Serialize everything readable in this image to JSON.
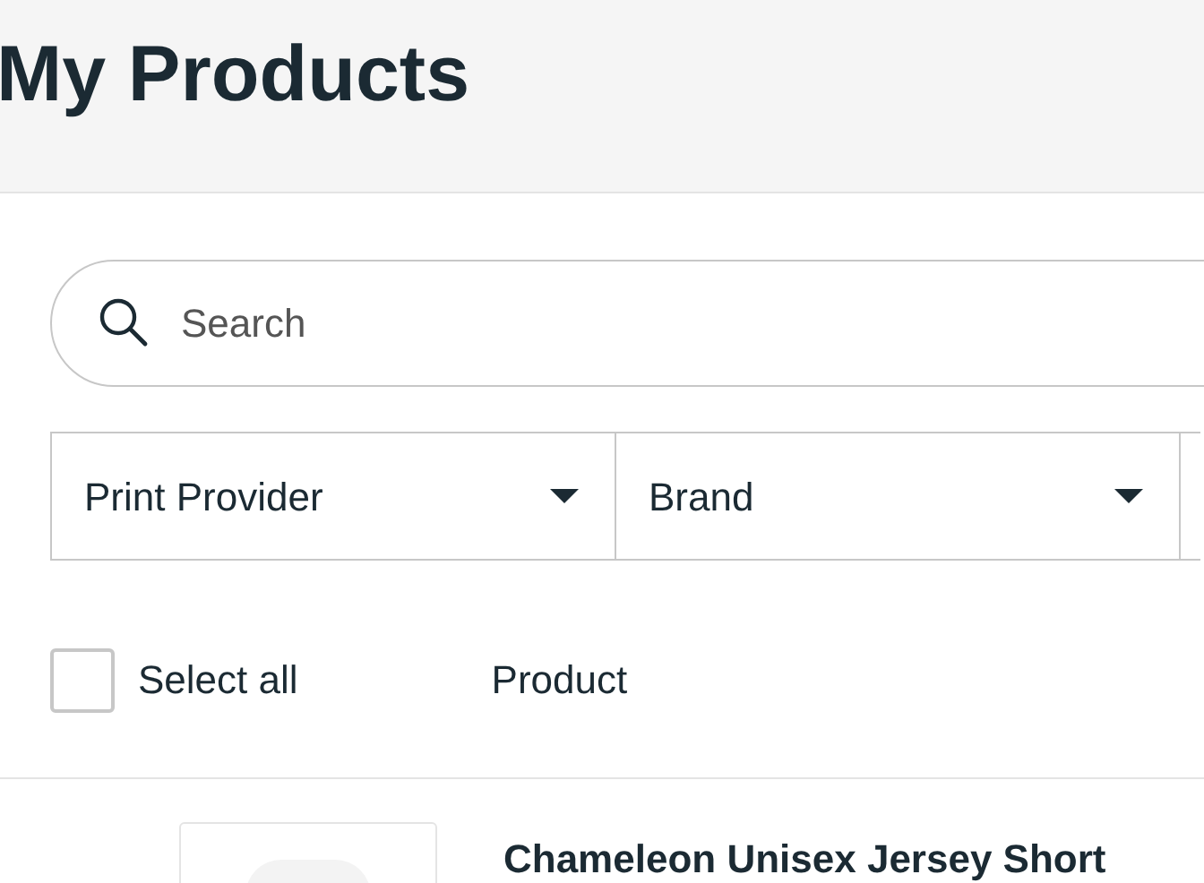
{
  "page": {
    "title": "My Products"
  },
  "search": {
    "placeholder": "Search"
  },
  "filters": [
    {
      "label": "Print Provider"
    },
    {
      "label": "Brand"
    }
  ],
  "list_header": {
    "select_all": {
      "label": "Select all",
      "checked": false
    },
    "column": "Product"
  },
  "products": [
    {
      "title": "Chameleon Unisex Jersey Short"
    }
  ]
}
